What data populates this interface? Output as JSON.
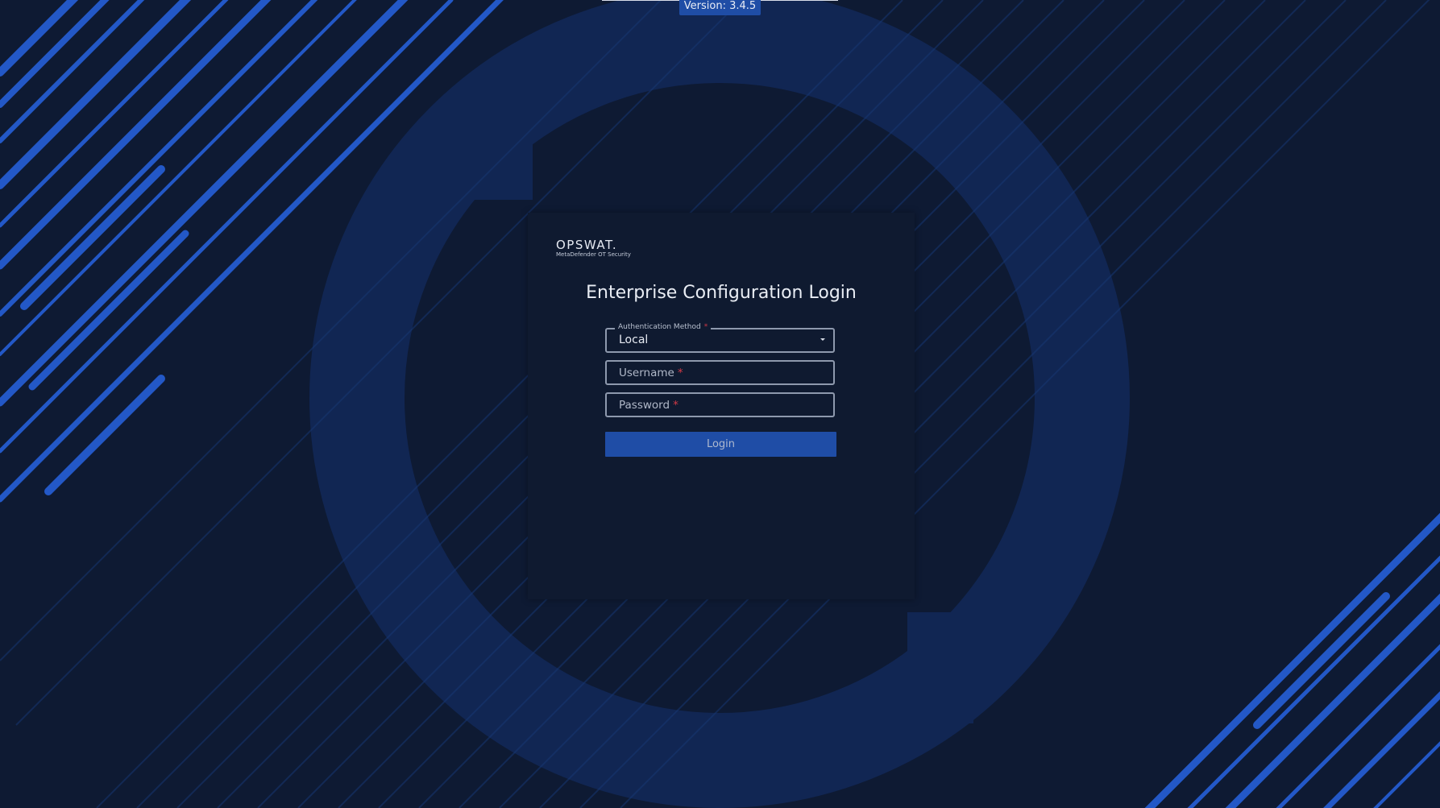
{
  "version": {
    "label": "Version: 3.4.5"
  },
  "logo": {
    "brand": "OPSWAT.",
    "product": "MetaDefender OT Security"
  },
  "login": {
    "title": "Enterprise Configuration Login",
    "auth_method": {
      "label": "Authentication Method",
      "value": "Local",
      "required_mark": "*"
    },
    "username": {
      "placeholder": "Username",
      "value": "",
      "required_mark": "*"
    },
    "password": {
      "placeholder": "Password",
      "value": "",
      "required_mark": "*"
    },
    "submit_label": "Login"
  },
  "icons": {
    "dropdown": "chevron-down-icon"
  },
  "colors": {
    "background": "#0e1a33",
    "accent": "#1f4da6",
    "stripe": "#2358c7",
    "card": "#0f1a30",
    "required": "#d23a46"
  }
}
